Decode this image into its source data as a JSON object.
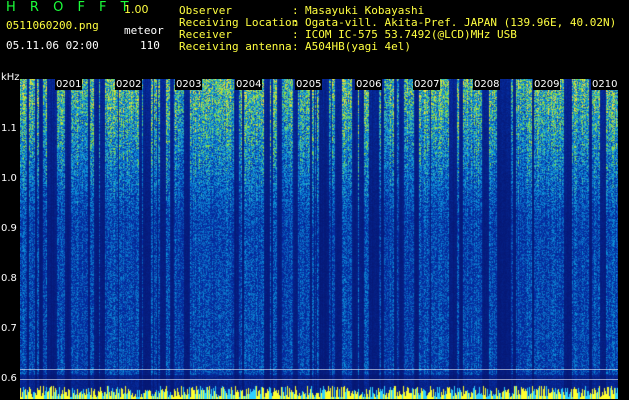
{
  "header": {
    "app_title": "H R O F F T",
    "version": "1.00",
    "file_name": "0511060200.png",
    "mode": "meteor",
    "datetime": "05.11.06 02:00",
    "count": "110"
  },
  "info": [
    {
      "label": "Observer",
      "value": "Masayuki Kobayashi"
    },
    {
      "label": "Receiving Location",
      "value": "Ogata-vill. Akita-Pref. JAPAN (139.96E, 40.02N)"
    },
    {
      "label": "Receiver",
      "value": "ICOM IC-575 53.7492(@LCD)MHz USB"
    },
    {
      "label": "Receiving antenna",
      "value": "A504HB(yagi 4el)"
    }
  ],
  "axis": {
    "y_unit": "kHz",
    "y_ticks": [
      "1.1",
      "1.0",
      "0.9",
      "0.8",
      "0.7",
      "0.6"
    ],
    "x_ticks": [
      "0201",
      "0202",
      "0203",
      "0204",
      "0205",
      "0206",
      "0207",
      "0208",
      "0209",
      "0210"
    ]
  },
  "colors": {
    "background": "#000000",
    "title_green": "#1bff3a",
    "text_yellow": "#ffff40",
    "spectrogram_base": "#0a1c86"
  }
}
